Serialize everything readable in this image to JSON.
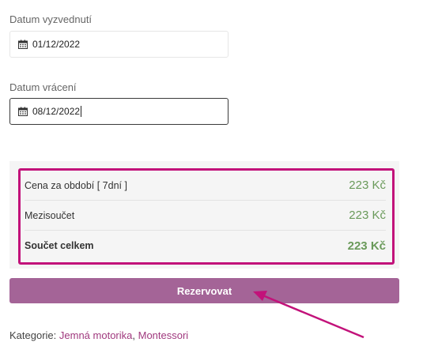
{
  "pickup": {
    "label": "Datum vyzvednutí",
    "value": "01/12/2022",
    "icon": "calendar-icon"
  },
  "return": {
    "label": "Datum vrácení",
    "value": "08/12/2022",
    "icon": "calendar-icon"
  },
  "summary": {
    "rows": [
      {
        "name": "Cena za období [ 7dní ]",
        "price": "223 Kč"
      },
      {
        "name": "Mezisoučet",
        "price": "223 Kč"
      },
      {
        "name": "Součet celkem",
        "price": "223 Kč"
      }
    ],
    "highlight_color": "#c2127a",
    "price_color": "#6a9a5a"
  },
  "reserve_button": {
    "label": "Rezervovat",
    "color": "#a46497"
  },
  "categories": {
    "prefix": "Kategorie:",
    "links": [
      "Jemná motorika",
      "Montessori"
    ],
    "separator": ", "
  },
  "annotation": {
    "arrow_color": "#c2127a"
  }
}
